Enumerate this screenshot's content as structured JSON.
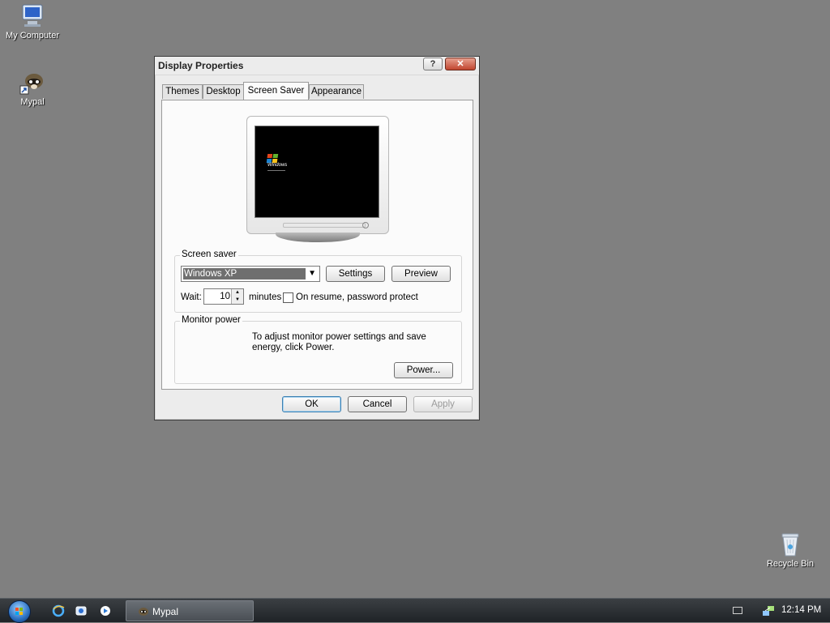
{
  "desktop": {
    "icons": [
      {
        "label": "My Computer",
        "icon": "my-computer-icon"
      },
      {
        "label": "Mypal",
        "icon": "mypal-icon"
      },
      {
        "label": "Recycle Bin",
        "icon": "recycle-bin-icon"
      }
    ]
  },
  "window": {
    "title": "Display Properties",
    "help_button": "?",
    "close_button": "✕",
    "tabs": [
      {
        "label": "Themes"
      },
      {
        "label": "Desktop"
      },
      {
        "label": "Screen Saver",
        "active": true
      },
      {
        "label": "Appearance"
      }
    ],
    "preview_brand": "Windows",
    "screen_saver": {
      "group_label": "Screen saver",
      "selected": "Windows XP",
      "settings_button": "Settings",
      "preview_button": "Preview",
      "wait_label": "Wait:",
      "wait_value": "10",
      "minutes_label": "minutes",
      "password_protect_label": "On resume, password protect",
      "password_protect_checked": false
    },
    "monitor_power": {
      "group_label": "Monitor power",
      "description": "To adjust monitor power settings and save energy, click Power.",
      "power_button": "Power..."
    },
    "buttons": {
      "ok": "OK",
      "cancel": "Cancel",
      "apply": "Apply"
    }
  },
  "taskbar": {
    "task": "Mypal",
    "clock": "12:14 PM"
  }
}
